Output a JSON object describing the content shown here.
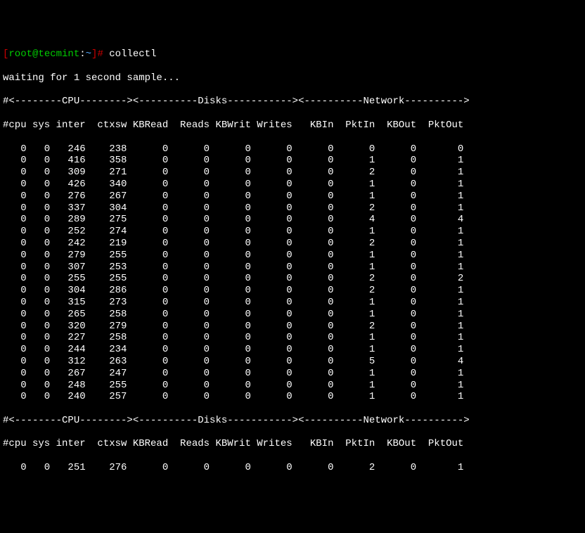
{
  "prompt": {
    "bracket_open": "[",
    "user_host": "root@tecmint",
    "colon": ":",
    "path": "~",
    "bracket_close": "]",
    "hash": "#",
    "command": " collectl"
  },
  "waiting": "waiting for 1 second sample...",
  "section_header": "#<--------CPU--------><----------Disks-----------><----------Network---------->",
  "columns_header": "#cpu sys inter  ctxsw KBRead  Reads KBWrit Writes   KBIn  PktIn  KBOut  PktOut ",
  "rows1": [
    {
      "cpu": 0,
      "sys": 0,
      "inter": 246,
      "ctxsw": 238,
      "kbread": 0,
      "reads": 0,
      "kbwrit": 0,
      "writes": 0,
      "kbin": 0,
      "pktin": 0,
      "kbout": 0,
      "pktout": 0
    },
    {
      "cpu": 0,
      "sys": 0,
      "inter": 416,
      "ctxsw": 358,
      "kbread": 0,
      "reads": 0,
      "kbwrit": 0,
      "writes": 0,
      "kbin": 0,
      "pktin": 1,
      "kbout": 0,
      "pktout": 1
    },
    {
      "cpu": 0,
      "sys": 0,
      "inter": 309,
      "ctxsw": 271,
      "kbread": 0,
      "reads": 0,
      "kbwrit": 0,
      "writes": 0,
      "kbin": 0,
      "pktin": 2,
      "kbout": 0,
      "pktout": 1
    },
    {
      "cpu": 0,
      "sys": 0,
      "inter": 426,
      "ctxsw": 340,
      "kbread": 0,
      "reads": 0,
      "kbwrit": 0,
      "writes": 0,
      "kbin": 0,
      "pktin": 1,
      "kbout": 0,
      "pktout": 1
    },
    {
      "cpu": 0,
      "sys": 0,
      "inter": 276,
      "ctxsw": 267,
      "kbread": 0,
      "reads": 0,
      "kbwrit": 0,
      "writes": 0,
      "kbin": 0,
      "pktin": 1,
      "kbout": 0,
      "pktout": 1
    },
    {
      "cpu": 0,
      "sys": 0,
      "inter": 337,
      "ctxsw": 304,
      "kbread": 0,
      "reads": 0,
      "kbwrit": 0,
      "writes": 0,
      "kbin": 0,
      "pktin": 2,
      "kbout": 0,
      "pktout": 1
    },
    {
      "cpu": 0,
      "sys": 0,
      "inter": 289,
      "ctxsw": 275,
      "kbread": 0,
      "reads": 0,
      "kbwrit": 0,
      "writes": 0,
      "kbin": 0,
      "pktin": 4,
      "kbout": 0,
      "pktout": 4
    },
    {
      "cpu": 0,
      "sys": 0,
      "inter": 252,
      "ctxsw": 274,
      "kbread": 0,
      "reads": 0,
      "kbwrit": 0,
      "writes": 0,
      "kbin": 0,
      "pktin": 1,
      "kbout": 0,
      "pktout": 1
    },
    {
      "cpu": 0,
      "sys": 0,
      "inter": 242,
      "ctxsw": 219,
      "kbread": 0,
      "reads": 0,
      "kbwrit": 0,
      "writes": 0,
      "kbin": 0,
      "pktin": 2,
      "kbout": 0,
      "pktout": 1
    },
    {
      "cpu": 0,
      "sys": 0,
      "inter": 279,
      "ctxsw": 255,
      "kbread": 0,
      "reads": 0,
      "kbwrit": 0,
      "writes": 0,
      "kbin": 0,
      "pktin": 1,
      "kbout": 0,
      "pktout": 1
    },
    {
      "cpu": 0,
      "sys": 0,
      "inter": 307,
      "ctxsw": 253,
      "kbread": 0,
      "reads": 0,
      "kbwrit": 0,
      "writes": 0,
      "kbin": 0,
      "pktin": 1,
      "kbout": 0,
      "pktout": 1
    },
    {
      "cpu": 0,
      "sys": 0,
      "inter": 255,
      "ctxsw": 255,
      "kbread": 0,
      "reads": 0,
      "kbwrit": 0,
      "writes": 0,
      "kbin": 0,
      "pktin": 2,
      "kbout": 0,
      "pktout": 2
    },
    {
      "cpu": 0,
      "sys": 0,
      "inter": 304,
      "ctxsw": 286,
      "kbread": 0,
      "reads": 0,
      "kbwrit": 0,
      "writes": 0,
      "kbin": 0,
      "pktin": 2,
      "kbout": 0,
      "pktout": 1
    },
    {
      "cpu": 0,
      "sys": 0,
      "inter": 315,
      "ctxsw": 273,
      "kbread": 0,
      "reads": 0,
      "kbwrit": 0,
      "writes": 0,
      "kbin": 0,
      "pktin": 1,
      "kbout": 0,
      "pktout": 1
    },
    {
      "cpu": 0,
      "sys": 0,
      "inter": 265,
      "ctxsw": 258,
      "kbread": 0,
      "reads": 0,
      "kbwrit": 0,
      "writes": 0,
      "kbin": 0,
      "pktin": 1,
      "kbout": 0,
      "pktout": 1
    },
    {
      "cpu": 0,
      "sys": 0,
      "inter": 320,
      "ctxsw": 279,
      "kbread": 0,
      "reads": 0,
      "kbwrit": 0,
      "writes": 0,
      "kbin": 0,
      "pktin": 2,
      "kbout": 0,
      "pktout": 1
    },
    {
      "cpu": 0,
      "sys": 0,
      "inter": 227,
      "ctxsw": 258,
      "kbread": 0,
      "reads": 0,
      "kbwrit": 0,
      "writes": 0,
      "kbin": 0,
      "pktin": 1,
      "kbout": 0,
      "pktout": 1
    },
    {
      "cpu": 0,
      "sys": 0,
      "inter": 244,
      "ctxsw": 234,
      "kbread": 0,
      "reads": 0,
      "kbwrit": 0,
      "writes": 0,
      "kbin": 0,
      "pktin": 1,
      "kbout": 0,
      "pktout": 1
    },
    {
      "cpu": 0,
      "sys": 0,
      "inter": 312,
      "ctxsw": 263,
      "kbread": 0,
      "reads": 0,
      "kbwrit": 0,
      "writes": 0,
      "kbin": 0,
      "pktin": 5,
      "kbout": 0,
      "pktout": 4
    },
    {
      "cpu": 0,
      "sys": 0,
      "inter": 267,
      "ctxsw": 247,
      "kbread": 0,
      "reads": 0,
      "kbwrit": 0,
      "writes": 0,
      "kbin": 0,
      "pktin": 1,
      "kbout": 0,
      "pktout": 1
    },
    {
      "cpu": 0,
      "sys": 0,
      "inter": 248,
      "ctxsw": 255,
      "kbread": 0,
      "reads": 0,
      "kbwrit": 0,
      "writes": 0,
      "kbin": 0,
      "pktin": 1,
      "kbout": 0,
      "pktout": 1
    },
    {
      "cpu": 0,
      "sys": 0,
      "inter": 240,
      "ctxsw": 257,
      "kbread": 0,
      "reads": 0,
      "kbwrit": 0,
      "writes": 0,
      "kbin": 0,
      "pktin": 1,
      "kbout": 0,
      "pktout": 1
    }
  ],
  "rows2": [
    {
      "cpu": 0,
      "sys": 0,
      "inter": 251,
      "ctxsw": 276,
      "kbread": 0,
      "reads": 0,
      "kbwrit": 0,
      "writes": 0,
      "kbin": 0,
      "pktin": 2,
      "kbout": 0,
      "pktout": 1
    }
  ]
}
